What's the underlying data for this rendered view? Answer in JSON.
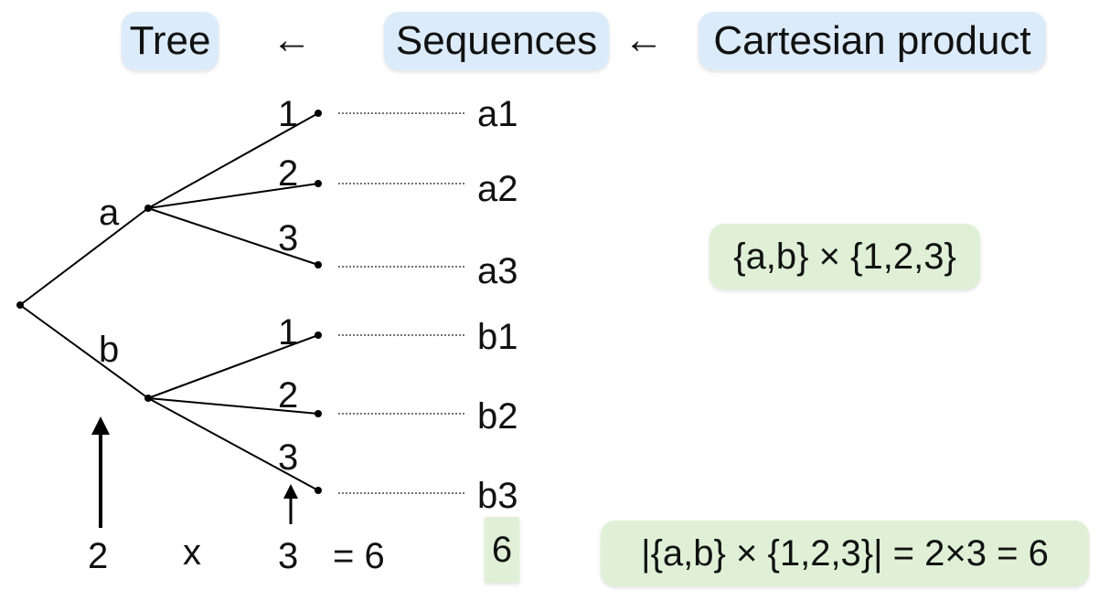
{
  "header": {
    "tree": "Tree",
    "sequences": "Sequences",
    "cartesian": "Cartesian product",
    "arrow1": "←",
    "arrow2": "←"
  },
  "tree": {
    "first_level": [
      "a",
      "b"
    ],
    "second_level": [
      "1",
      "2",
      "3",
      "1",
      "2",
      "3"
    ],
    "sequences": [
      "a1",
      "a2",
      "a3",
      "b1",
      "b2",
      "b3"
    ]
  },
  "counting": {
    "left_count": "2",
    "times": "x",
    "right_count": "3",
    "result": "= 6",
    "sequence_count": "6"
  },
  "formulas": {
    "product": "{a,b} × {1,2,3}",
    "cardinality": "|{a,b} × {1,2,3}| = 2×3 = 6"
  }
}
